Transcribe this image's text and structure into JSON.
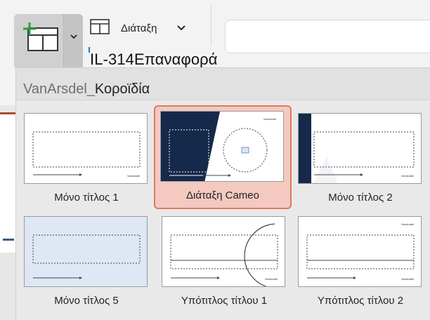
{
  "ribbon": {
    "new_slide_icon": "new-slide-layout-icon",
    "layout_label": "Διάταξη",
    "layout_icon": "layout-icon",
    "reset_label": "ΙL-314Επαναφορά"
  },
  "gallery": {
    "title_muted": "VanArsdel_",
    "title_main": "Κοροϊδία",
    "layouts": [
      {
        "label": "Μόνο τίτλος 1",
        "selected": false
      },
      {
        "label": "Διάταξη Cameo",
        "selected": true
      },
      {
        "label": "Μόνο τίτλος 2",
        "selected": false
      },
      {
        "label": "Μόνο τίτλος 5",
        "selected": false
      },
      {
        "label": "Υπότιτλος τίτλου 1",
        "selected": false
      },
      {
        "label": "Υπότιτλος τίτλου 2",
        "selected": false
      }
    ],
    "thumb_brand_text": "VanArsdel"
  },
  "colors": {
    "accent_selected_bg": "#f3c9c0",
    "accent_selected_border": "#e07a5f",
    "navy": "#15294a",
    "new_slide_plus": "#2e9e44"
  }
}
